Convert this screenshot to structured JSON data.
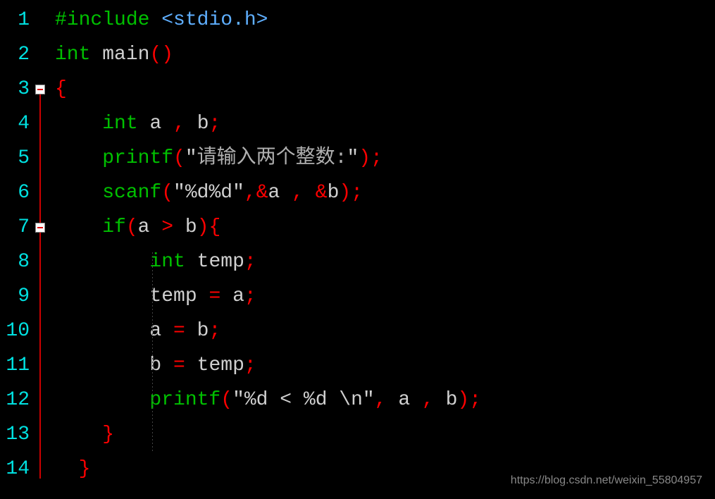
{
  "watermark": "https://blog.csdn.net/weixin_55804957",
  "line_numbers": [
    "1",
    "2",
    "3",
    "4",
    "5",
    "6",
    "7",
    "8",
    "9",
    "10",
    "11",
    "12",
    "13",
    "14"
  ],
  "fold_markers": [
    3,
    7
  ],
  "code": {
    "l1": {
      "preproc": "#include ",
      "header": "<stdio.h>"
    },
    "l2": {
      "kw": "int",
      "sp1": " ",
      "name": "main",
      "lp": "(",
      "rp": ")"
    },
    "l3": {
      "brace": "{"
    },
    "l4": {
      "indent": "    ",
      "kw": "int",
      "sp": " ",
      "a": "a",
      "c1": " , ",
      "b": "b",
      "semi": ";"
    },
    "l5": {
      "indent": "    ",
      "fn": "printf",
      "lp": "(",
      "q1": "\"",
      "str": "请输入两个整数:",
      "q2": "\"",
      "rp": ")",
      "semi": ";"
    },
    "l6": {
      "indent": "    ",
      "fn": "scanf",
      "lp": "(",
      "q1": "\"",
      "str": "%d%d",
      "q2": "\"",
      "c1": ",",
      "amp1": "&",
      "a": "a",
      "c2": " , ",
      "amp2": "&",
      "b": "b",
      "rp": ")",
      "semi": ";"
    },
    "l7": {
      "indent": "    ",
      "kw": "if",
      "lp": "(",
      "a": "a",
      "op": " > ",
      "b": "b",
      "rp": ")",
      "brace": "{"
    },
    "l8": {
      "indent": "        ",
      "kw": "int",
      "sp": " ",
      "temp": "temp",
      "semi": ";"
    },
    "l9": {
      "indent": "        ",
      "temp": "temp",
      "op": " = ",
      "a": "a",
      "semi": ";"
    },
    "l10": {
      "indent": "        ",
      "a": "a",
      "op": " = ",
      "b": "b",
      "semi": ";"
    },
    "l11": {
      "indent": "        ",
      "b": "b",
      "op": " = ",
      "temp": "temp",
      "semi": ";"
    },
    "l12": {
      "indent": "        ",
      "fn": "printf",
      "lp": "(",
      "q1": "\"",
      "str": "%d < %d \\n",
      "q2": "\"",
      "c1": ", ",
      "a": "a",
      "c2": " , ",
      "b": "b",
      "rp": ")",
      "semi": ";"
    },
    "l13": {
      "indent": "    ",
      "brace": "}"
    },
    "l14": {
      "indent": "  ",
      "brace": "}"
    }
  }
}
